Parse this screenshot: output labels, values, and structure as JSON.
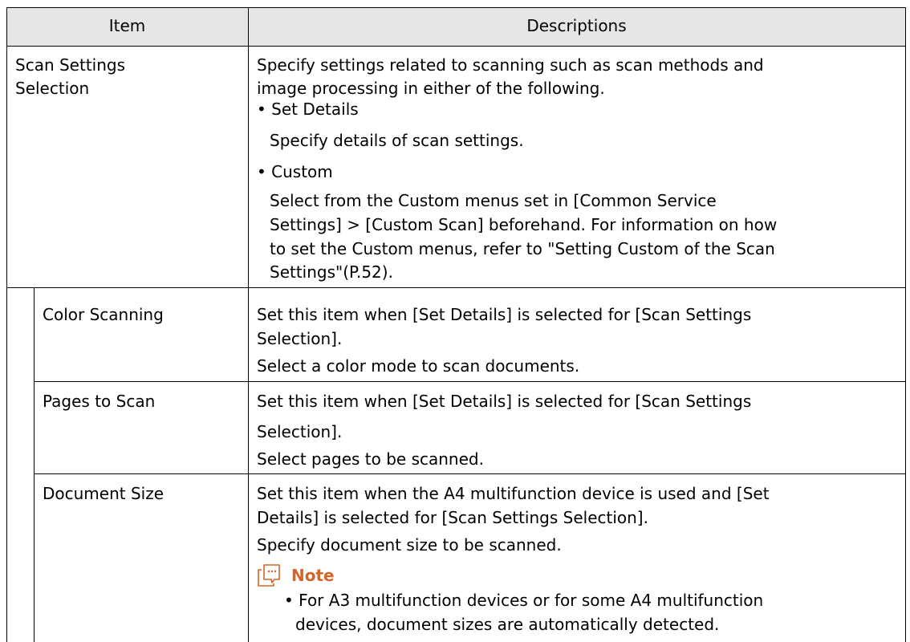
{
  "table": {
    "headers": {
      "item": "Item",
      "descriptions": "Descriptions"
    },
    "rows": [
      {
        "item_lines": [
          "Scan Settings",
          "Selection"
        ],
        "intro_lines": [
          "Specify settings related to scanning such as scan methods and",
          "image processing in either of the following."
        ],
        "options": [
          {
            "bullet": "• Set Details",
            "desc_lines": [
              "Specify details of scan settings."
            ]
          },
          {
            "bullet": "• Custom",
            "desc_lines": [
              "Select from the Custom menus set in [Common Service",
              "Settings] > [Custom Scan] beforehand. For information on how",
              "to set the Custom menus, refer to \"Setting Custom of the Scan",
              "Settings\"(P.52)."
            ]
          }
        ]
      },
      {
        "item": "Color Scanning",
        "desc_lines": [
          "Set this item when [Set Details] is selected for [Scan Settings",
          "Selection].",
          "Select a color mode to scan documents."
        ]
      },
      {
        "item": "Pages to Scan",
        "desc_lines": [
          "Set this item when [Set Details] is selected for [Scan Settings",
          "Selection].",
          "Select pages to be scanned."
        ]
      },
      {
        "item": "Document Size",
        "desc_lines": [
          "Set this item when the A4 multifunction device is used and [Set",
          "Details] is selected for [Scan Settings Selection].",
          "Specify document size to be scanned."
        ],
        "note": {
          "label": "Note",
          "icon": "note-icon",
          "lines": [
            "• For A3 multifunction devices or for some A4 multifunction",
            "devices, document sizes are automatically detected."
          ]
        }
      }
    ]
  },
  "colors": {
    "note_accent": "#d4652a",
    "header_bg": "#e6e6e6",
    "border": "#000000"
  }
}
